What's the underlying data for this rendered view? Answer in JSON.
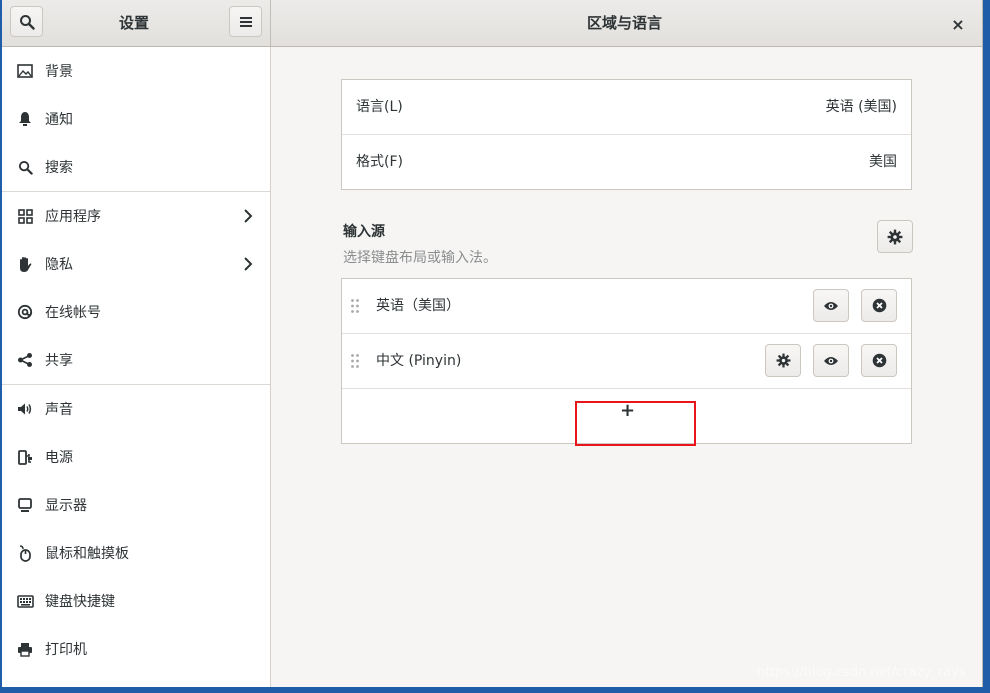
{
  "sidebar_header": {
    "title": "设置"
  },
  "panel_header": {
    "title": "区域与语言"
  },
  "icons": {
    "close": "×",
    "add": "+"
  },
  "sidebar": {
    "items": [
      {
        "label": "背景",
        "icon": "image-icon"
      },
      {
        "label": "通知",
        "icon": "bell-icon"
      },
      {
        "label": "搜索",
        "icon": "search-icon"
      },
      {
        "label": "应用程序",
        "icon": "apps-grid-icon",
        "chevron": true
      },
      {
        "label": "隐私",
        "icon": "hand-icon",
        "chevron": true
      },
      {
        "label": "在线帐号",
        "icon": "at-sign-icon"
      },
      {
        "label": "共享",
        "icon": "share-icon"
      },
      {
        "label": "声音",
        "icon": "speaker-icon"
      },
      {
        "label": "电源",
        "icon": "power-plug-icon"
      },
      {
        "label": "显示器",
        "icon": "monitor-icon"
      },
      {
        "label": "鼠标和触摸板",
        "icon": "mouse-icon"
      },
      {
        "label": "键盘快捷键",
        "icon": "keyboard-icon"
      },
      {
        "label": "打印机",
        "icon": "printer-icon"
      }
    ]
  },
  "region": {
    "language_label": "语言(L)",
    "language_value": "英语 (美国)",
    "format_label": "格式(F)",
    "format_value": "美国"
  },
  "input_sources": {
    "title": "输入源",
    "subtitle": "选择键盘布局或输入法。",
    "items": [
      {
        "label": "英语（美国）",
        "has_settings": false
      },
      {
        "label": "中文 (Pinyin)",
        "has_settings": true
      }
    ]
  },
  "watermark": "https://blog.csdn.net/crazy_rays",
  "colors": {
    "highlight": "#e8161b",
    "desktop": "#1f5da8"
  }
}
